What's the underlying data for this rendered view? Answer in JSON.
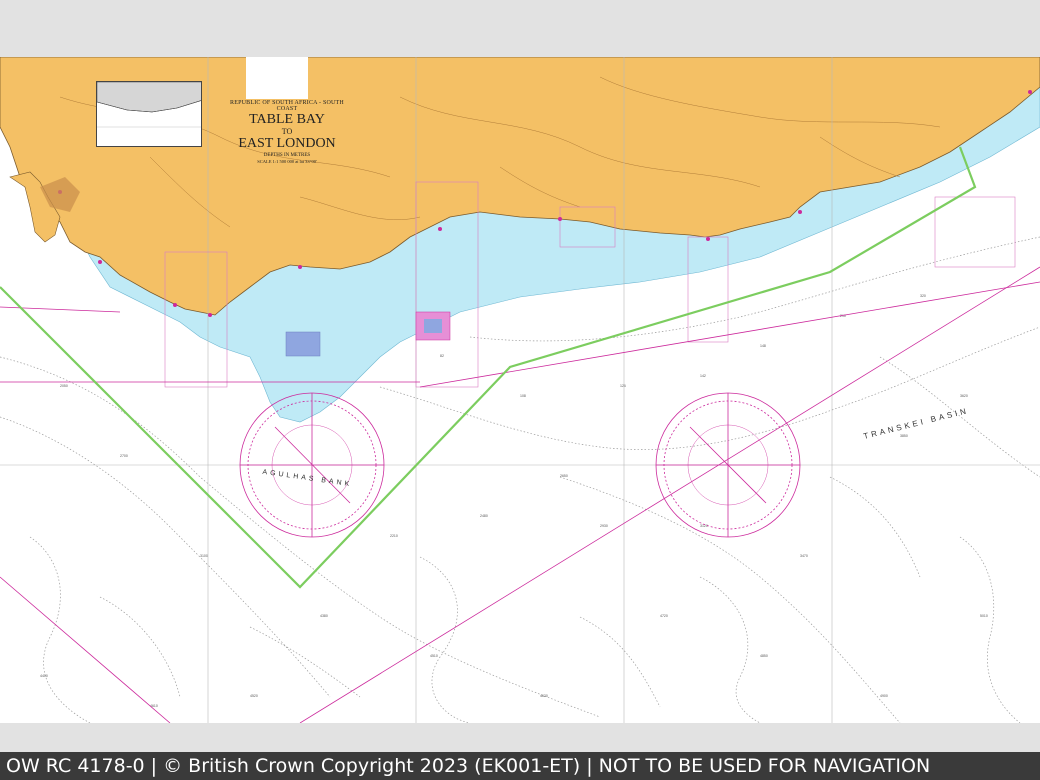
{
  "chart": {
    "title_region": "REPUBLIC OF SOUTH AFRICA - SOUTH COAST",
    "title_main_1": "TABLE BAY",
    "title_to": "TO",
    "title_main_2": "EAST LONDON",
    "title_depths": "DEPTHS IN METRES",
    "title_scale": "SCALE 1:1 500 000 at lat 33°00'",
    "agulhas_bank_label": "AGULHAS BANK",
    "transkei_basin_label": "TRANSKEI BASIN"
  },
  "colors": {
    "land": "#f4c065",
    "shallow_water": "#bfeaf6",
    "deep_water": "#ffffff",
    "magenta": "#cc2a9c",
    "green_route": "#7ccd5f",
    "coast": "#7a5a2c",
    "footer_bg": "#3a3a3a"
  },
  "footer": {
    "text": "OW RC 4178-0 | © British Crown Copyright 2023 (EK001-ET) | NOT TO BE USED FOR NAVIGATION"
  }
}
